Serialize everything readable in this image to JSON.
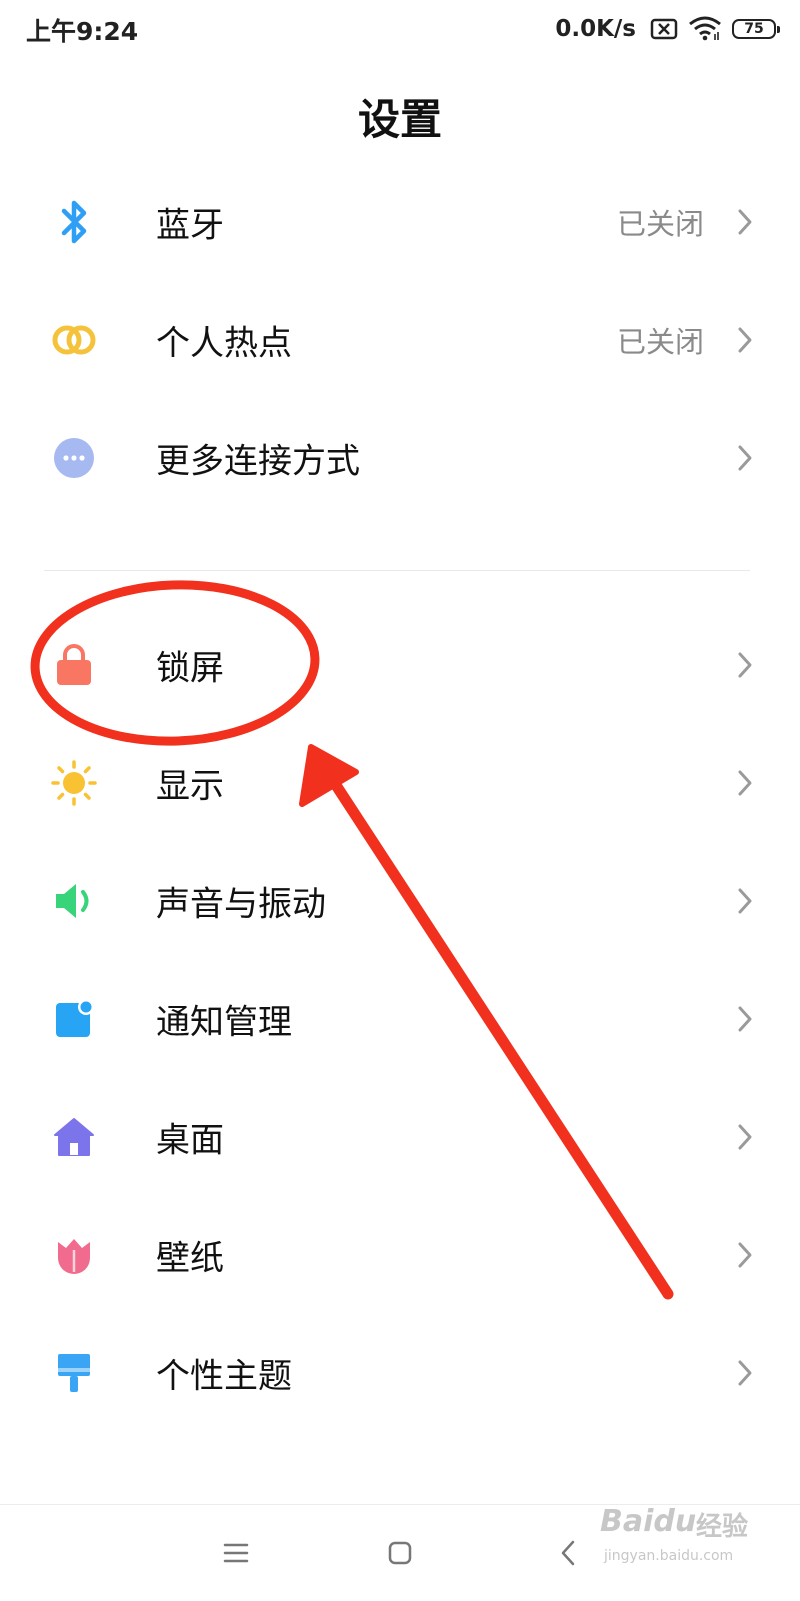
{
  "status_bar": {
    "time": "上午9:24",
    "network_speed": "0.0K/s",
    "sim_icon": "sim-none-icon",
    "wifi_icon": "wifi-icon",
    "battery_level": "75"
  },
  "header": {
    "title": "设置"
  },
  "connections": [
    {
      "label": "蓝牙",
      "status": "已关闭",
      "icon": "bluetooth-icon",
      "icon_color": "#2f9ef5"
    },
    {
      "label": "个人热点",
      "status": "已关闭",
      "icon": "hotspot-icon",
      "icon_color": "#f5c33b"
    },
    {
      "label": "更多连接方式",
      "status": "",
      "icon": "more-connections-icon",
      "icon_color": "#a6b9f0"
    }
  ],
  "personalization": [
    {
      "label": "锁屏",
      "icon": "lock-icon",
      "icon_color": "#f87662"
    },
    {
      "label": "显示",
      "icon": "sun-icon",
      "icon_color": "#f8c233"
    },
    {
      "label": "声音与振动",
      "icon": "speaker-icon",
      "icon_color": "#37d47a"
    },
    {
      "label": "通知管理",
      "icon": "notification-icon",
      "icon_color": "#28a4f5"
    },
    {
      "label": "桌面",
      "icon": "home-icon",
      "icon_color": "#7b74ea"
    },
    {
      "label": "壁纸",
      "icon": "tulip-icon",
      "icon_color": "#f06b8d"
    },
    {
      "label": "个性主题",
      "icon": "paintbrush-icon",
      "icon_color": "#3aa5f5"
    }
  ],
  "annotation": {
    "color": "#f2301e",
    "highlighted_item": "锁屏"
  },
  "nav_bar": {
    "menu_icon": "menu-icon",
    "home_icon": "home-square-icon",
    "back_icon": "back-icon"
  },
  "watermark": {
    "brand": "Baidu",
    "brand_cn": "经验",
    "url": "jingyan.baidu.com"
  }
}
